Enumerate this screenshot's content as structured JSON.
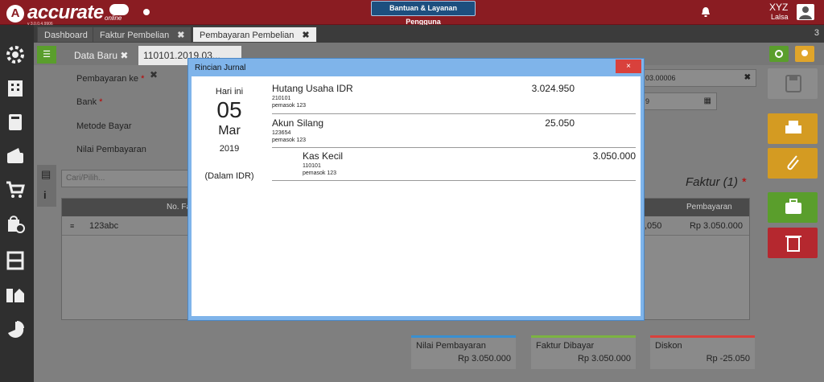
{
  "header": {
    "logo_text": "accurate",
    "logo_sub": "online",
    "logo_version": "v 3.0.0.4.9906",
    "help_button": "Bantuan & Layanan Pengguna",
    "user_name": "XYZ",
    "user_sub": "Lalsa"
  },
  "tabs": [
    {
      "label": "Dashboard"
    },
    {
      "label": "Faktur Pembelian"
    },
    {
      "label": "Pembayaran Pembelian"
    }
  ],
  "tab_count": "3",
  "subtabs": [
    {
      "label": "Data Baru"
    },
    {
      "label": "110101.2019.03..."
    }
  ],
  "form": {
    "pembayaran_ke": "Pembayaran ke",
    "bank": "Bank",
    "metode_bayar": "Metode Bayar",
    "nilai_pembayaran": "Nilai Pembayaran",
    "field_no": "03.00006",
    "field_date": "9"
  },
  "search": {
    "placeholder": "Cari/Pilih..."
  },
  "faktur_title": "Faktur (1)",
  "grid": {
    "col_no": "No. Fa",
    "col_pembayaran": "Pembayaran",
    "row_no": "123abc",
    "row_partial": ",050",
    "row_pembayaran": "Rp 3.050.000"
  },
  "summary": [
    {
      "label": "Nilai Pembayaran",
      "value": "Rp 3.050.000",
      "color": "#3a8fd0"
    },
    {
      "label": "Faktur Dibayar",
      "value": "Rp 3.050.000",
      "color": "#7cb342"
    },
    {
      "label": "Diskon",
      "value": "Rp -25.050",
      "color": "#d9413c"
    }
  ],
  "modal": {
    "title": "Rincian Jurnal",
    "close": "×",
    "date_label": "Hari ini",
    "day": "05",
    "month": "Mar",
    "year": "2019",
    "currency": "(Dalam IDR)",
    "entries": [
      {
        "name": "Hutang Usaha IDR",
        "code": "210101",
        "desc": "pemasok 123",
        "debit": "3.024.950",
        "credit": ""
      },
      {
        "name": "Akun Silang",
        "code": "123654",
        "desc": "pemasok 123",
        "debit": "25.050",
        "credit": ""
      },
      {
        "name": "Kas Kecil",
        "code": "110101",
        "desc": "pemasok 123",
        "debit": "",
        "credit": "3.050.000"
      }
    ]
  },
  "colors": {
    "header_bg": "#8a1c22",
    "modal_frame": "#7fb4ea",
    "close_red": "#d9413c"
  }
}
